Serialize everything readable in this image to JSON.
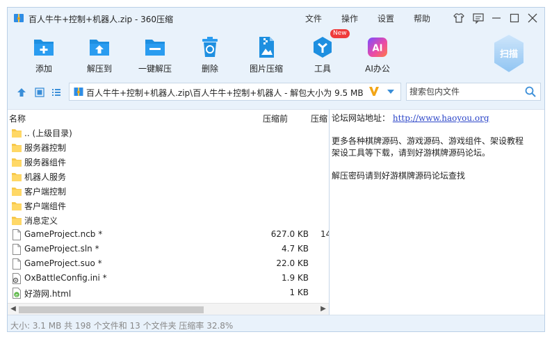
{
  "window": {
    "title": "百人牛牛+控制+机器人.zip - 360压缩",
    "menu": [
      "文件",
      "操作",
      "设置",
      "帮助"
    ]
  },
  "toolbar": {
    "items": [
      {
        "label": "添加",
        "icon": "add-file-icon"
      },
      {
        "label": "解压到",
        "icon": "extract-to-icon"
      },
      {
        "label": "一键解压",
        "icon": "one-click-extract-icon"
      },
      {
        "label": "删除",
        "icon": "delete-icon"
      },
      {
        "label": "图片压缩",
        "icon": "image-compress-icon"
      },
      {
        "label": "工具",
        "icon": "tools-icon"
      },
      {
        "label": "AI办公",
        "icon": "ai-office-icon"
      }
    ],
    "new_badge": "New",
    "ai_text": "AI",
    "scan_label": "扫描"
  },
  "address": {
    "path": "百人牛牛+控制+机器人.zip\\百人牛牛+控制+机器人 - 解包大小为 9.5 MB"
  },
  "search": {
    "placeholder": "搜索包内文件"
  },
  "filelist": {
    "col_name": "名称",
    "col_compressed": "压缩前",
    "col_ratio": "压缩",
    "rows": [
      {
        "name": ".. (上级目录)",
        "size": "",
        "ratio": "",
        "type": "folder"
      },
      {
        "name": "服务器控制",
        "size": "",
        "ratio": "",
        "type": "folder"
      },
      {
        "name": "服务器组件",
        "size": "",
        "ratio": "",
        "type": "folder"
      },
      {
        "name": "机器人服务",
        "size": "",
        "ratio": "",
        "type": "folder"
      },
      {
        "name": "客户端控制",
        "size": "",
        "ratio": "",
        "type": "folder"
      },
      {
        "name": "客户端组件",
        "size": "",
        "ratio": "",
        "type": "folder"
      },
      {
        "name": "消息定义",
        "size": "",
        "ratio": "",
        "type": "folder"
      },
      {
        "name": "GameProject.ncb *",
        "size": "627.0 KB",
        "ratio": "14",
        "type": "file"
      },
      {
        "name": "GameProject.sln *",
        "size": "4.7 KB",
        "ratio": "",
        "type": "file"
      },
      {
        "name": "GameProject.suo *",
        "size": "22.0 KB",
        "ratio": "",
        "type": "file"
      },
      {
        "name": "OxBattleConfig.ini *",
        "size": "1.9 KB",
        "ratio": "",
        "type": "ini"
      },
      {
        "name": "好游网.html",
        "size": "1 KB",
        "ratio": "",
        "type": "html"
      }
    ]
  },
  "comment": {
    "line1_label": "论坛网站地址：",
    "line1_link": "http://www.haoyou.org",
    "line2": "更多各种棋牌源码、游戏源码、游戏组件、架设教程",
    "line3": "架设工具等下载，请到好游棋牌源码论坛。",
    "line4": "解压密码请到好游棋牌源码论坛查找"
  },
  "status": {
    "text": "大小: 3.1 MB 共 198 个文件和 13 个文件夹 压缩率 32.8%"
  },
  "colors": {
    "accent": "#1e8fe0",
    "window_bg": "#e9f2fb",
    "folder": "#f7c84a",
    "link": "#2b45c8",
    "status_text": "#888888"
  }
}
